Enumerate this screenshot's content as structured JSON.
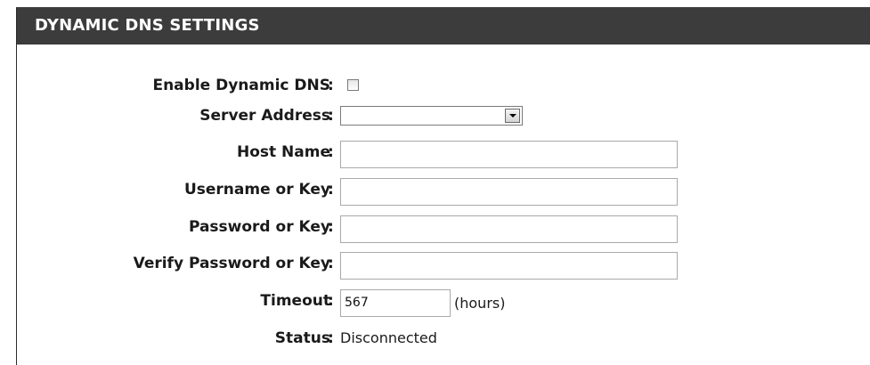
{
  "section": {
    "title": "DYNAMIC DNS SETTINGS"
  },
  "fields": {
    "enable_ddns": {
      "label": "Enable Dynamic DNS",
      "checked": false
    },
    "server_address": {
      "label": "Server Address",
      "value": ""
    },
    "host_name": {
      "label": "Host Name",
      "value": ""
    },
    "username": {
      "label": "Username or Key",
      "value": ""
    },
    "password": {
      "label": "Password or Key",
      "value": ""
    },
    "verify_password": {
      "label": "Verify Password or Key",
      "value": ""
    },
    "timeout": {
      "label": "Timeout",
      "value": "567",
      "unit": "(hours)"
    },
    "status": {
      "label": "Status",
      "value": "Disconnected"
    }
  },
  "separator": ":"
}
